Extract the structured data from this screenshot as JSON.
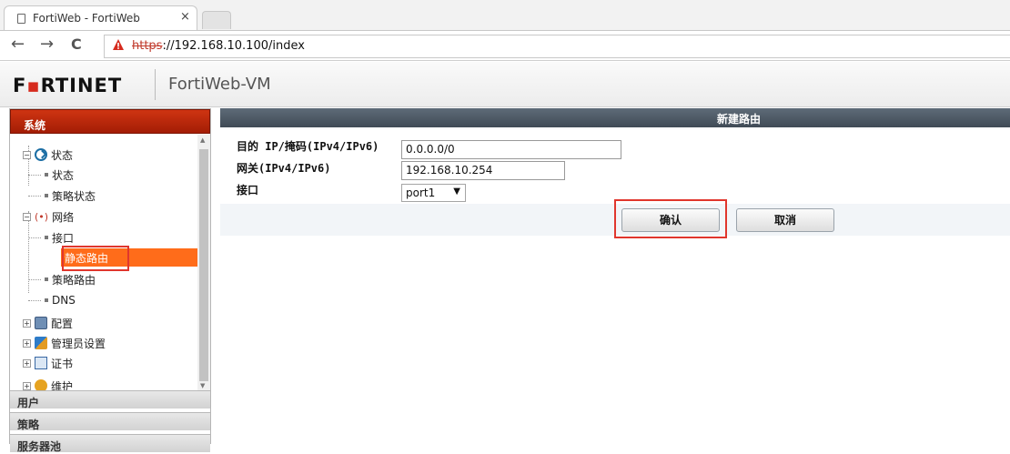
{
  "browser": {
    "tab_title": "FortiWeb - FortiWeb",
    "tab_close": "×",
    "nav_back": "←",
    "nav_forward": "→",
    "nav_reload": "C",
    "url_scheme": "https",
    "url_rest": "://192.168.10.100/index"
  },
  "header": {
    "logo_text": "F▪RTINET",
    "product": "FortiWeb-VM"
  },
  "sidebar": {
    "title": "系统",
    "tree": {
      "status": "状态",
      "status_child": "状态",
      "policy_status": "策略状态",
      "network": "网络",
      "interface": "接口",
      "static_route": "静态路由",
      "policy_route": "策略路由",
      "dns": "DNS",
      "config": "配置",
      "admin": "管理员设置",
      "cert": "证书",
      "maintenance": "维护"
    },
    "accordion": [
      "用户",
      "策略",
      "服务器池"
    ]
  },
  "form": {
    "title": "新建路由",
    "dest_label": "目的 IP/掩码(IPv4/IPv6)",
    "dest_value": "0.0.0.0/0",
    "gateway_label": "网关(IPv4/IPv6)",
    "gateway_value": "192.168.10.254",
    "interface_label": "接口",
    "interface_value": "port1",
    "ok_label": "确认",
    "cancel_label": "取消"
  },
  "colors": {
    "brand_red": "#d62b1e",
    "selected_orange": "#ff6c1a",
    "highlight_red": "#e0362d"
  },
  "icons": [
    "page-icon",
    "warning-icon",
    "status-icon",
    "network-icon",
    "config-icon",
    "admin-icon",
    "cert-icon",
    "maintenance-icon"
  ]
}
